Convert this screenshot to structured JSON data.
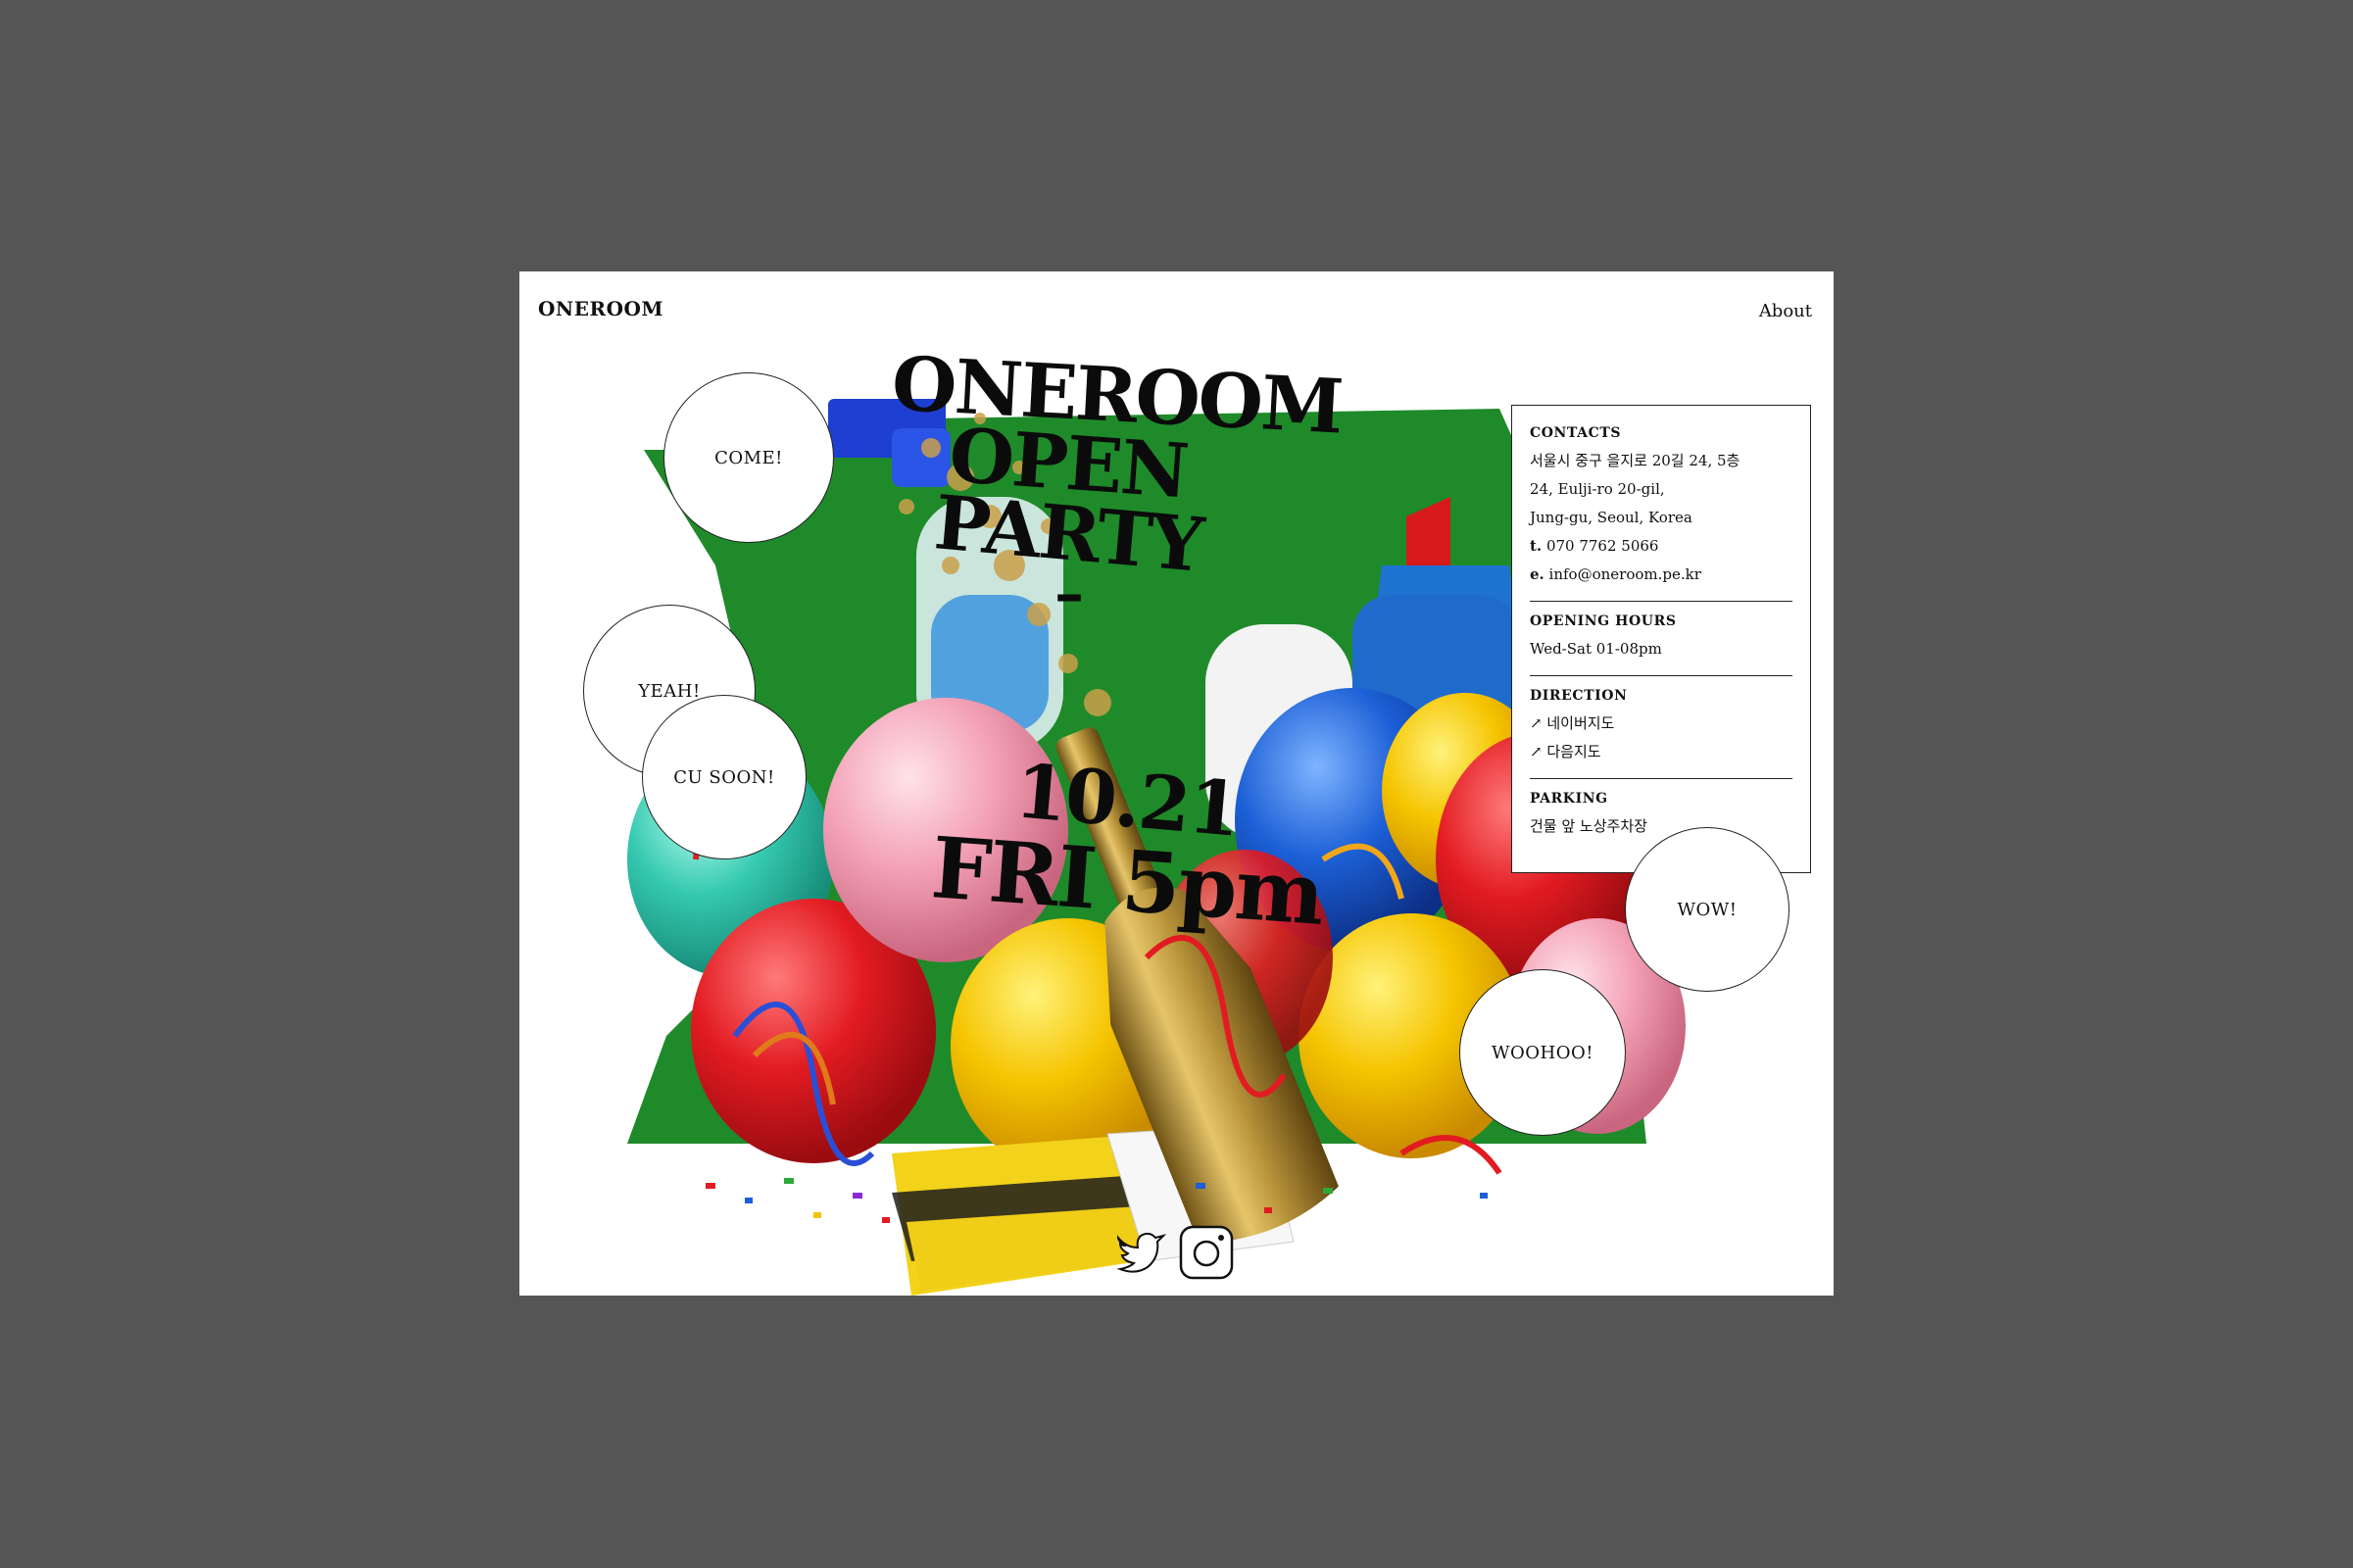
{
  "header": {
    "logo": "ONEROOM",
    "nav_about": "About"
  },
  "poster": {
    "title_lines": [
      "ONEROOM",
      "OPEN",
      "PARTY"
    ],
    "separator": "–",
    "date": "10.21",
    "day_time": "FRI 5pm"
  },
  "bubbles": {
    "come": "COME!",
    "yeah": "YEAH!",
    "cu_soon": "CU SOON!",
    "wow": "WOW!",
    "woohoo": "WOOHOO!"
  },
  "info": {
    "contacts": {
      "heading": "CONTACTS",
      "address_kr": "서울시 중구 을지로 20길 24, 5층",
      "address_en_1": "24, Eulji-ro 20-gil,",
      "address_en_2": "Jung-gu, Seoul, Korea",
      "phone_prefix": "t.",
      "phone": "070 7762 5066",
      "email_prefix": "e.",
      "email": "info@oneroom.pe.kr"
    },
    "hours": {
      "heading": "OPENING HOURS",
      "value": "Wed-Sat 01-08pm"
    },
    "direction": {
      "heading": "DIRECTION",
      "links": [
        "네이버지도",
        "다음지도"
      ]
    },
    "parking": {
      "heading": "PARKING",
      "value": "건물 앞 노상주차장"
    }
  },
  "icons": [
    "twitter-bird-icon",
    "instagram-icon",
    "link-arrow-icon"
  ],
  "colors": {
    "page_bg": "#555555",
    "card_bg": "#ffffff",
    "green_shape": "#1f8a2a",
    "balloon_red": "#e21b22",
    "balloon_yellow": "#f5c400",
    "balloon_blue": "#1c5fd6",
    "balloon_pink": "#f3a1b6",
    "balloon_teal": "#35c9b0",
    "bottle_gold": "#b8933a"
  }
}
